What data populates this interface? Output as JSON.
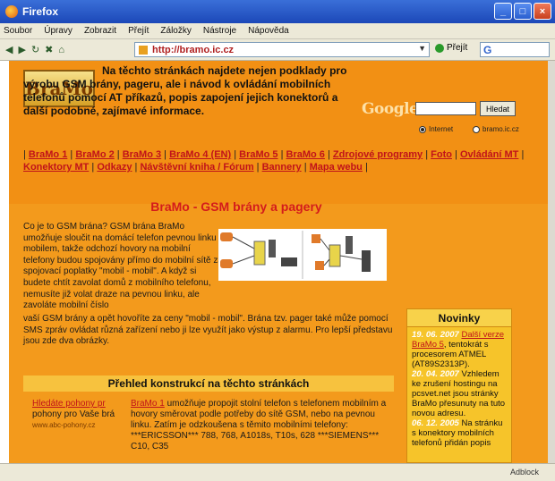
{
  "window": {
    "title": "Firefox",
    "controls": [
      "_",
      "□",
      "×"
    ]
  },
  "menu": [
    "Soubor",
    "Úpravy",
    "Zobrazit",
    "Přejít",
    "Záložky",
    "Nástroje",
    "Nápověda"
  ],
  "toolbar": {
    "url": "http://bramo.ic.cz",
    "go_label": "Přejít",
    "search_logo": "G"
  },
  "header": {
    "logo": "BraMo",
    "intro": "Na těchto stránkách najdete nejen podklady pro výrobu GSM brány, pageru, ale i návod k ovládání mobilních telefonů pomocí AT příkazů, popis zapojení jejich konektorů a další podobné, zajímavé informace."
  },
  "google": {
    "logo": "Google",
    "button": "Hledat",
    "radio_internet": "Internet",
    "radio_site": "bramo.ic.cz"
  },
  "nav": [
    "BraMo 1",
    "BraMo 2",
    "BraMo 3",
    "BraMo 4 (EN)",
    "BraMo 5",
    "BraMo 6",
    "Zdrojové programy",
    "Foto",
    "Ovládání MT",
    "Konektory MT",
    "Odkazy",
    "Návštěvní kniha / Fórum",
    "Bannery",
    "Mapa webu"
  ],
  "main": {
    "title": "BraMo - GSM brány a pagery",
    "body": "Co je to GSM brána? GSM brána BraMo umožňuje sloučit na domácí telefon pevnou linku s mobilem, takže odchozí hovory na mobilní telefony budou spojovány přímo do mobilní sítě za spojovací poplatky \"mobil - mobil\". A když si budete chtít zavolat domů z mobilního telefonu, nemusíte již volat draze na pevnou linku, ale zavoláte mobilní číslo",
    "body2": "vaší GSM brány a opět hovoříte za ceny \"mobil - mobil\". Brána tzv. pager také může pomocí SMS zpráv ovládat různá zařízení nebo ji lze využít jako výstup z alarmu. Pro lepší představu jsou zde dva obrázky."
  },
  "news": {
    "title": "Novinky",
    "items": [
      {
        "date": "19. 06. 2007",
        "link": "Další verze BraMo 5",
        "text": ", tentokrát s procesorem ATMEL (AT89S2313P)."
      },
      {
        "date": "20. 04. 2007",
        "link": "",
        "text": " Vzhledem ke zrušení hostingu na pcsvet.net jsou stránky BraMo přesunuty na tuto novou adresu."
      },
      {
        "date": "06. 12. 2005",
        "link": "",
        "text": " Na stránku s konektory mobilních telefonů přidán popis"
      }
    ]
  },
  "section": {
    "title": "Přehled konstrukcí na těchto stránkách"
  },
  "left_col": {
    "link": "Hledáte pohony pr",
    "text": "pohony pro Vaše brá",
    "small": "www.abc-pohony.cz"
  },
  "center_col": {
    "link": "BraMo 1",
    "text": " umožňuje propojit stolní telefon s telefonem mobilním a hovory směrovat podle potřeby do sítě GSM, nebo na pevnou linku. Zatím je odzkoušena s těmito mobilními telefony: ***ERICSSON*** 788, 768, A1018s, T10s, 628 ***SIEMENS*** C10, C35"
  },
  "status": {
    "adblock": "Adblock"
  }
}
